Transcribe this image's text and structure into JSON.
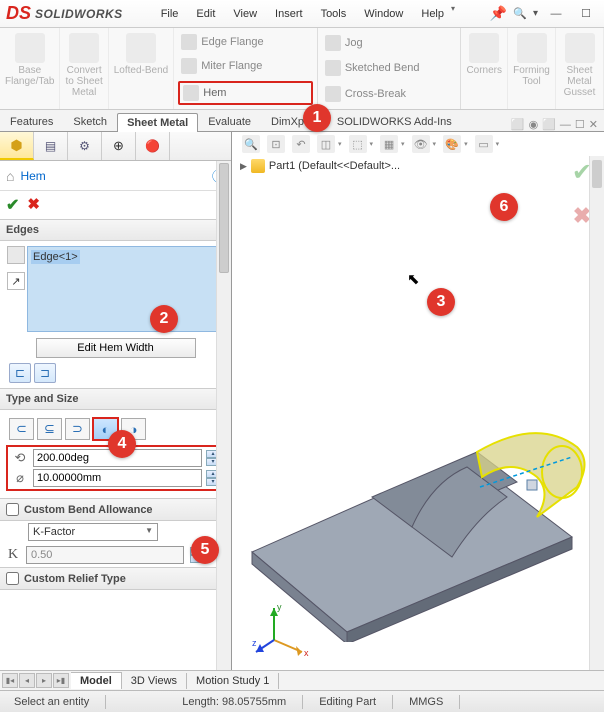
{
  "app": {
    "name": "SOLIDWORKS",
    "ds": "DS"
  },
  "menu": [
    "File",
    "Edit",
    "View",
    "Insert",
    "Tools",
    "Window",
    "Help"
  ],
  "ribbon": {
    "base": "Base\nFlange/Tab",
    "convert": "Convert\nto Sheet\nMetal",
    "lofted": "Lofted-Bend",
    "edge_flange": "Edge Flange",
    "miter_flange": "Miter Flange",
    "hem": "Hem",
    "jog": "Jog",
    "sketched_bend": "Sketched Bend",
    "cross_break": "Cross-Break",
    "corners": "Corners",
    "forming": "Forming\nTool",
    "gusset": "Sheet\nMetal\nGusset"
  },
  "tabs": [
    "Features",
    "Sketch",
    "Sheet Metal",
    "Evaluate",
    "DimXpert",
    "SOLIDWORKS Add-Ins"
  ],
  "feature": {
    "title": "Hem",
    "edges_header": "Edges",
    "edge_item": "Edge<1>",
    "edit_hem_width": "Edit Hem Width",
    "type_size_header": "Type and Size",
    "angle": "200.00deg",
    "radius": "10.00000mm",
    "custom_bend": "Custom Bend Allowance",
    "k_factor": "K-Factor",
    "k_value": "0.50",
    "custom_relief": "Custom Relief Type"
  },
  "tree": {
    "part": "Part1 (Default<<Default>..."
  },
  "bottom_tabs": [
    "Model",
    "3D Views",
    "Motion Study 1"
  ],
  "status": {
    "prompt": "Select an entity",
    "length": "Length: 98.05755mm",
    "mode": "Editing Part",
    "units": "MMGS"
  },
  "badges": {
    "b1": "1",
    "b2": "2",
    "b3": "3",
    "b4": "4",
    "b5": "5",
    "b6": "6"
  },
  "k_label": "K"
}
